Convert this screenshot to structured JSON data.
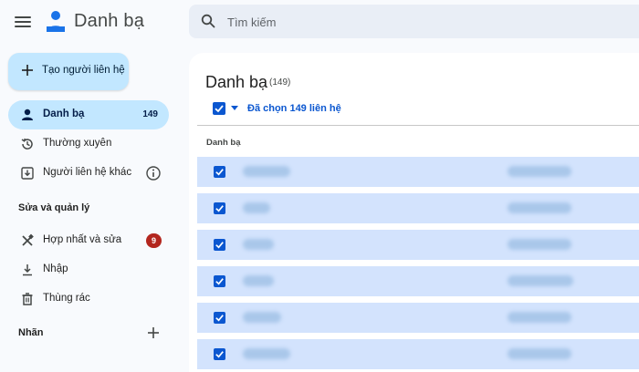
{
  "app": {
    "title": "Danh bạ"
  },
  "search": {
    "placeholder": "Tìm kiếm"
  },
  "sidebar": {
    "create_label": "Tạo người liên hệ",
    "items": [
      {
        "label": "Danh bạ",
        "count": "149",
        "active": true
      },
      {
        "label": "Thường xuyên"
      },
      {
        "label": "Người liên hệ khác"
      }
    ],
    "section_manage": "Sửa và quản lý",
    "manage_items": [
      {
        "label": "Hợp nhất và sửa",
        "badge": "9"
      },
      {
        "label": "Nhập"
      },
      {
        "label": "Thùng rác"
      }
    ],
    "section_labels": "Nhãn"
  },
  "main": {
    "title": "Danh bạ",
    "count": "(149)",
    "selected_text": "Đã chọn 149 liên hệ",
    "column_header": "Danh bạ",
    "rows": [
      {
        "name": "",
        "phone": ""
      },
      {
        "name": "",
        "phone": ""
      },
      {
        "name": "",
        "phone": ""
      },
      {
        "name": "",
        "phone": ""
      },
      {
        "name": "",
        "phone": ""
      },
      {
        "name": "",
        "phone": ""
      }
    ]
  },
  "colors": {
    "accent": "#0b57d0",
    "active_nav": "#c2e7ff",
    "row_selected": "#d3e3fd",
    "badge": "#b3261e",
    "background": "#f8fafd"
  }
}
